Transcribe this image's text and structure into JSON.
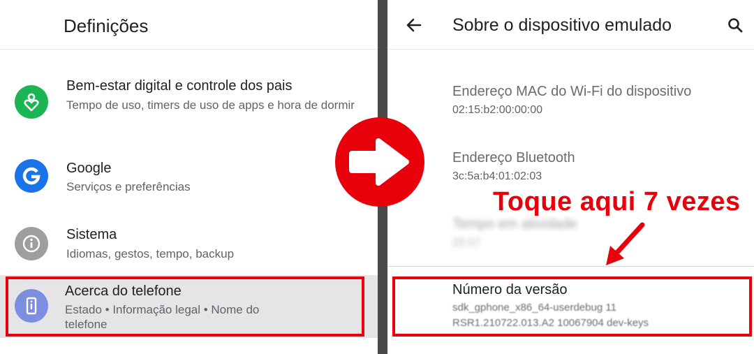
{
  "left": {
    "title": "Definições",
    "items": [
      {
        "title": "Bem-estar digital e controle dos pais",
        "subtitle": "Tempo de uso, timers de uso de apps e hora de dormir",
        "icon": "heart-person-icon"
      },
      {
        "title": "Google",
        "subtitle": "Serviços e preferências",
        "icon": "google-g-icon"
      },
      {
        "title": "Sistema",
        "subtitle": "Idiomas, gestos, tempo, backup",
        "icon": "info-icon"
      },
      {
        "title": "Acerca do telefone",
        "subtitle": "Estado • Informação legal • Nome do telefone",
        "icon": "phone-icon"
      }
    ]
  },
  "right": {
    "title": "Sobre o dispositivo emulado",
    "mac": {
      "title": "Endereço MAC do Wi-Fi do dispositivo",
      "value": "02:15:b2:00:00:00"
    },
    "bluetooth": {
      "title": "Endereço Bluetooth",
      "value": "3c:5a:b4:01:02:03"
    },
    "uptime": {
      "title": "Tempo em atividade",
      "value": "22:17"
    },
    "build": {
      "title": "Número da versão",
      "line1": "sdk_gphone_x86_64-userdebug 11",
      "line2": "RSR1.210722.013.A2 10067904 dev-keys"
    }
  },
  "annotation": {
    "text": "Toque aqui 7 vezes"
  },
  "colors": {
    "accent_red": "#e8000b",
    "divider": "#4a4a4a",
    "highlight_bg": "#e5e5e8"
  }
}
